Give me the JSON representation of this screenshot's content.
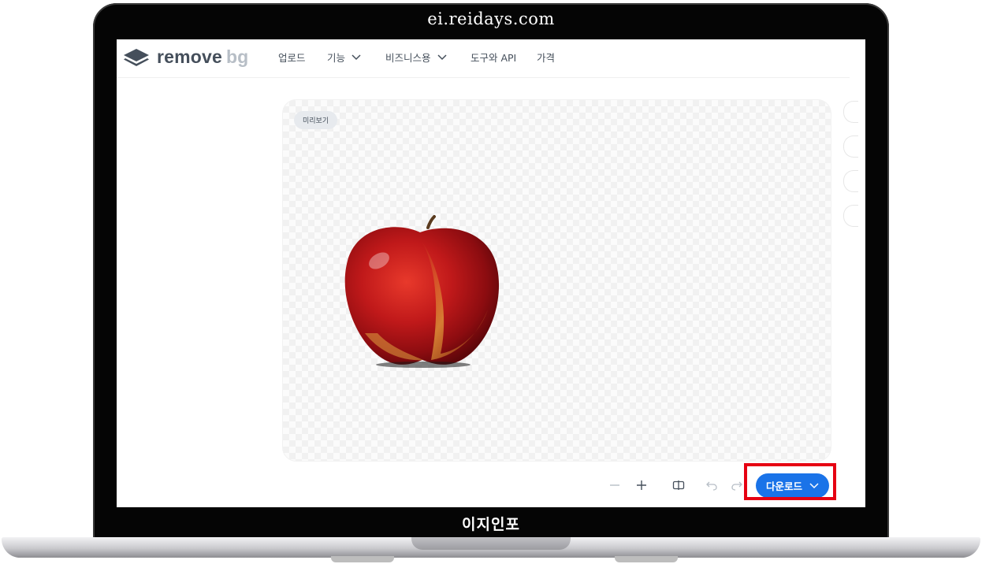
{
  "watermark": {
    "top": "ei.reidays.com",
    "bottom": "이지인포"
  },
  "logo": {
    "dark": "remove",
    "light": "bg"
  },
  "nav": [
    {
      "label": "업로드",
      "dropdown": false
    },
    {
      "label": "기능",
      "dropdown": true
    },
    {
      "label": "비즈니스용",
      "dropdown": true
    },
    {
      "label": "도구와 API",
      "dropdown": false
    },
    {
      "label": "가격",
      "dropdown": false
    }
  ],
  "preview": {
    "tag": "미리보기"
  },
  "toolbar": {
    "download_label": "다운로드"
  },
  "colors": {
    "accent": "#1a73e8",
    "highlight": "#e60012",
    "text": "#454f5b"
  }
}
